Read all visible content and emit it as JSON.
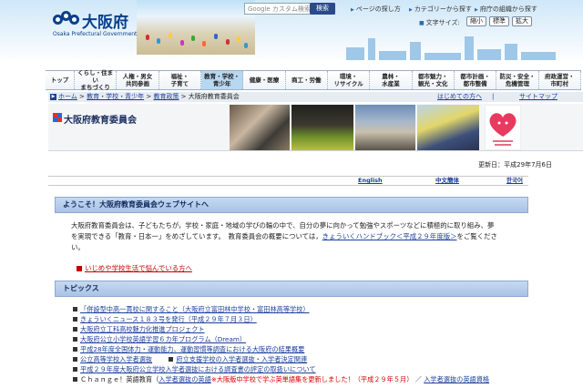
{
  "header": {
    "logo_title": "大阪府",
    "logo_subtitle": "Osaka Prefectural Government",
    "search_placeholder": "Google カスタム検索",
    "search_button": "検索",
    "links": [
      "ページの探し方",
      "カテゴリーから探す",
      "府庁の組織から探す"
    ],
    "font_size_label": "文字サイズ:",
    "font_sizes": [
      "縮小",
      "標準",
      "拡大"
    ]
  },
  "nav": [
    "トップ",
    "くらし・住まい\nまちづくり",
    "人権・男女\n共同参画",
    "福祉・\n子育て",
    "教育・学校・\n青少年",
    "健康・医療",
    "商工・労働",
    "環境・\nリサイクル",
    "農林・\n水産業",
    "都市魅力・\n観光・文化",
    "都市計画・\n都市整備",
    "防災・安全・\n危機管理",
    "府政運営・\n市町村"
  ],
  "breadcrumb": {
    "items": [
      "ホーム",
      "教育・学校・青少年",
      "教育政策"
    ],
    "current": "大阪府教育委員会",
    "right_links": [
      "はじめての方へ",
      "サイトマップ"
    ]
  },
  "banner": {
    "title": "大阪府教育委員会"
  },
  "updated": "更新日：平成29年7月6日",
  "languages": [
    "English",
    "中文簡体",
    "한국어"
  ],
  "welcome": {
    "heading": "ようこそ！大阪府教育委員会ウェブサイトへ",
    "text_line1": "大阪府教育委員会は、子どもたちが，学校・家庭・地域の学びの輪の中で、自分の夢に向かって勉強やスポーツなどに積極的に取り組み、夢",
    "text_line2_a": "を実現できる「教育・日本一」をめざしています。　教育委員会の概要については，",
    "text_line2_link": "きょういくハンドブック＜平成２９年度版＞",
    "text_line2_b": "をご覧くださ",
    "text_line3": "い。",
    "bullying_link": "いじめや学校生活で悩んでいる方へ"
  },
  "topics": {
    "heading": "トピックス",
    "items": [
      "「併設型中高一貫校に関すること（大阪府立富田林中学校・富田林高等学校）",
      "きょういくニュース１８３号を発行（平成２９年７月３日）",
      "大阪府立工科高校魅力化推進プロジェクト",
      "大阪府公立小学校英語学習６カ年プログラム（Dream）",
      "平成28年度全国体力・運動能力、運動習慣等調査における大阪府の結果概要",
      "公立高等学校入学者選抜",
      "平成２９年度大阪府公立学校入学者選抜における調査書の評定の取扱いについて"
    ],
    "item6_extra": "府立支援学校の入学者選抜・入学者決定関連",
    "item8_prefix": "Ｃｈａｎｇｅ！英語教育（",
    "item8_link1": "入学者選抜の英語",
    "item8_red": "※大阪版中学校で学ぶ英単語集を更新しました！（平成２９年５月）",
    "item8_sep": "／",
    "item8_link2": "入学者選抜の英語資格"
  }
}
